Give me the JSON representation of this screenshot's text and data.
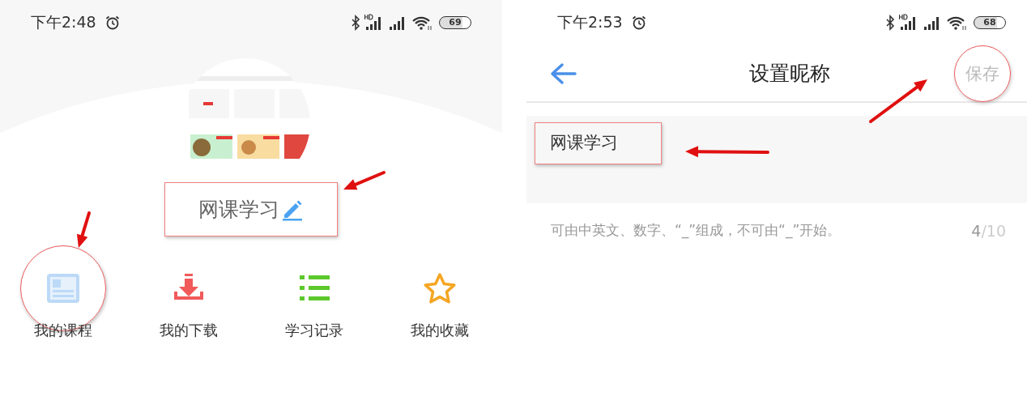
{
  "screens": [
    {
      "kind": "profile",
      "status_bar": {
        "time": "下午2:48",
        "battery": "69"
      },
      "nickname": {
        "text": "网课学习",
        "highlighted": true
      },
      "shortcuts": [
        {
          "label": "我的课程",
          "kind": "course",
          "highlighted": true
        },
        {
          "label": "我的下载",
          "kind": "download",
          "highlighted": false
        },
        {
          "label": "学习记录",
          "kind": "list",
          "highlighted": false
        },
        {
          "label": "我的收藏",
          "kind": "star",
          "highlighted": false
        }
      ],
      "arrows": [
        {
          "kind": "arrow"
        },
        {
          "kind": "arrow"
        }
      ]
    },
    {
      "kind": "edit",
      "status_bar": {
        "time": "下午2:53",
        "battery": "68"
      },
      "header": {
        "title": "设置昵称",
        "action": "保存",
        "action_highlighted": true
      },
      "input": {
        "value": "网课学习",
        "highlighted": true
      },
      "hint": "可由中英文、数字、“_”组成，不可由“_”开始。",
      "counter": {
        "count": "4",
        "limit": "/10"
      },
      "arrows": [
        {
          "kind": "arrow"
        },
        {
          "kind": "arrow"
        }
      ]
    }
  ]
}
